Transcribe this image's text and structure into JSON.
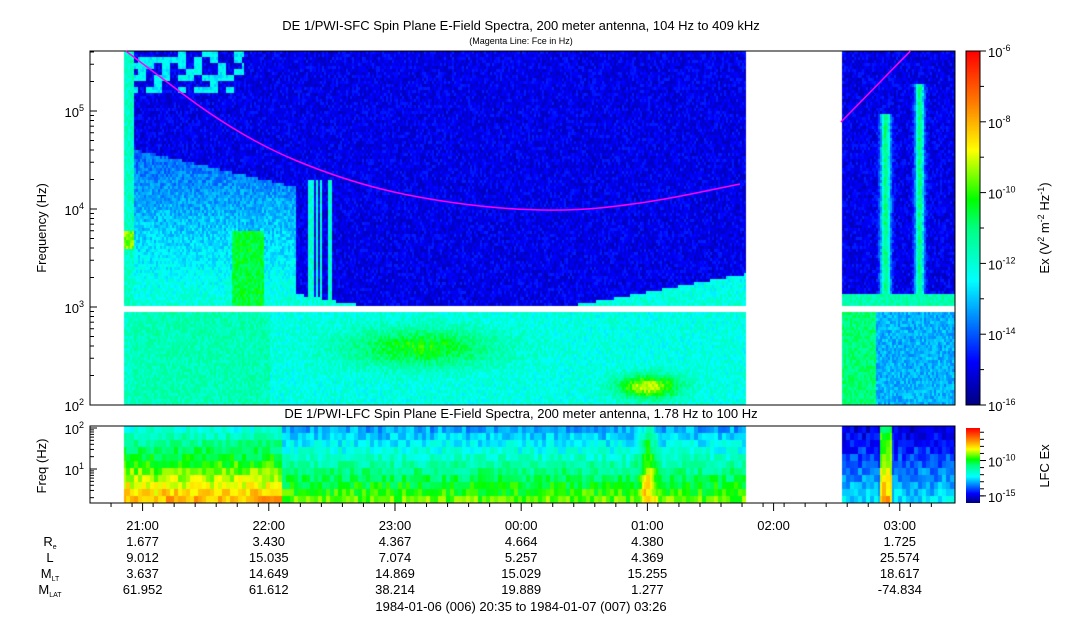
{
  "chart_data": [
    {
      "type": "heatmap",
      "title": "DE 1/PWI-SFC  Spin Plane E-Field Spectra, 200 meter antenna, 104 Hz to 409 kHz",
      "subtitle": "(Magenta Line: Fce in Hz)",
      "ylabel": "Frequency (Hz)",
      "yscale": "log",
      "ylim": [
        100,
        409000
      ],
      "yticks": [
        {
          "exp": "2"
        },
        {
          "exp": "3"
        },
        {
          "exp": "4"
        },
        {
          "exp": "5"
        }
      ],
      "xlim": [
        "20:35",
        "03:26"
      ],
      "data_gaps": [
        [
          "01:46",
          "02:32"
        ]
      ],
      "colorbar": {
        "label_main": "Ex (V",
        "label_sup1": "2",
        "label_mid": " m",
        "label_sup2": "-2",
        "label_end": " Hz",
        "label_sup3": "-1",
        "label_close": ")",
        "scale": "log",
        "range": [
          -16,
          -6
        ],
        "ticks": [
          {
            "exp": "-6"
          },
          {
            "exp": "-8"
          },
          {
            "exp": "-10"
          },
          {
            "exp": "-12"
          },
          {
            "exp": "-14"
          },
          {
            "exp": "-16"
          }
        ]
      },
      "fce_line": {
        "color": "#ff00ff",
        "segments": [
          [
            [
              "20:52",
              409000
            ],
            [
              "21:47",
              53000
            ],
            [
              "22:40",
              18000
            ],
            [
              "23:30",
              11000
            ],
            [
              "00:18",
              9300
            ],
            [
              "01:00",
              11500
            ],
            [
              "01:44",
              18000
            ]
          ],
          [
            [
              "02:32",
              77000
            ],
            [
              "03:05",
              409000
            ]
          ]
        ]
      }
    },
    {
      "type": "heatmap",
      "title": "DE 1/PWI-LFC  Spin Plane E-Field Spectra, 200 meter antenna, 1.78 Hz to 100 Hz",
      "ylabel": "Freq (Hz)",
      "yscale": "log",
      "ylim": [
        1.78,
        100
      ],
      "yticks": [
        {
          "exp": "1"
        },
        {
          "exp": "2"
        }
      ],
      "colorbar": {
        "label": "LFC Ex",
        "scale": "log",
        "range": [
          -16,
          -5.4
        ],
        "ticks": [
          {
            "exp": "-10"
          },
          {
            "exp": "-15"
          }
        ]
      }
    }
  ],
  "time_axis": {
    "ticks": [
      "21:00",
      "22:00",
      "23:00",
      "00:00",
      "01:00",
      "02:00",
      "03:00"
    ],
    "tick_hours": [
      21,
      22,
      23,
      24,
      25,
      26,
      27
    ]
  },
  "ephemeris": {
    "rows": [
      {
        "label": "R",
        "sub": "e",
        "values": [
          "1.677",
          "3.430",
          "4.367",
          "4.664",
          "4.380",
          "",
          "1.725"
        ]
      },
      {
        "label": "L",
        "sub": "",
        "values": [
          "9.012",
          "15.035",
          "7.074",
          "5.257",
          "4.369",
          "",
          "25.574"
        ]
      },
      {
        "label": "M",
        "sub": "LT",
        "values": [
          "3.637",
          "14.649",
          "14.869",
          "15.029",
          "15.255",
          "",
          "18.617"
        ]
      },
      {
        "label": "M",
        "sub": "LAT",
        "values": [
          "61.952",
          "61.612",
          "38.214",
          "19.889",
          "1.277",
          "",
          "-74.834"
        ]
      }
    ]
  },
  "date_range": "1984-01-06 (006) 20:35 to 1984-01-07 (007) 03:26",
  "colors": {
    "fce": "#ff00ff"
  }
}
